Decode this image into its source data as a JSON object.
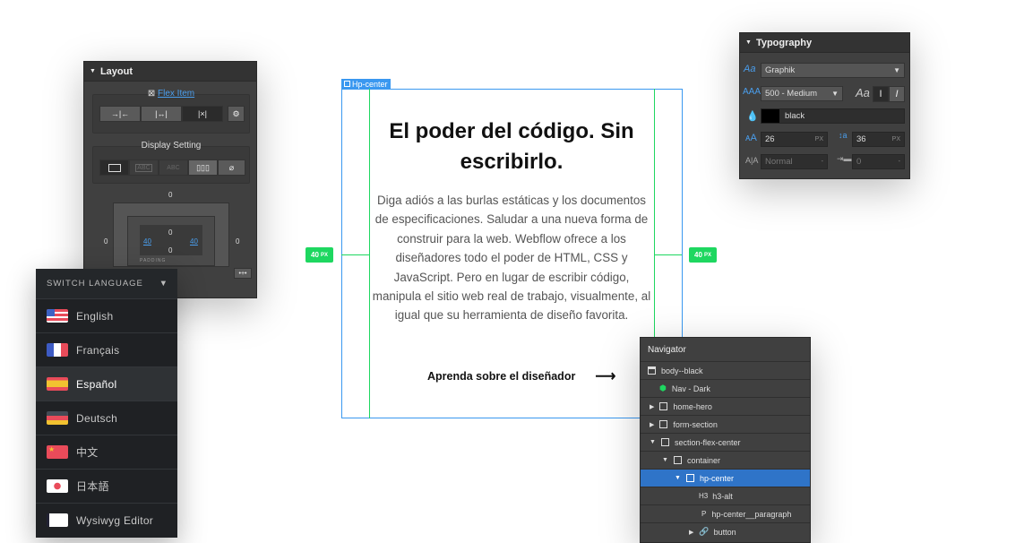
{
  "layout_panel": {
    "title": "Layout",
    "flex_item_label": "Flex Item",
    "display_setting_label": "Display Setting",
    "display_options": [
      "block",
      "inline-block",
      "inline",
      "flex",
      "none"
    ],
    "display_texts": [
      "ABC",
      "ABC"
    ],
    "margin": {
      "top": "0",
      "left": "0",
      "right": "0"
    },
    "padding": {
      "top": "0",
      "left": "40",
      "right": "40",
      "bottom": "0",
      "label": "PADDING"
    },
    "more_label": "•+•"
  },
  "language": {
    "title": "SWITCH LANGUAGE",
    "items": [
      {
        "label": "English",
        "flag": "us"
      },
      {
        "label": "Français",
        "flag": "fr"
      },
      {
        "label": "Español",
        "flag": "es",
        "selected": true
      },
      {
        "label": "Deutsch",
        "flag": "de"
      },
      {
        "label": "中文",
        "flag": "cn"
      },
      {
        "label": "日本語",
        "flag": "jp"
      },
      {
        "label": "Wysiwyg Editor",
        "flag": "doc"
      }
    ]
  },
  "canvas": {
    "element_label": "Hp-center",
    "padding_left": "40",
    "padding_right": "40",
    "unit": "PX",
    "heading": "El poder del código. Sin escribirlo.",
    "paragraph": "Diga adiós a las burlas estáticas y los documentos de especificaciones. Saludar a una nueva forma de construir para la web. Webflow ofrece a los diseñadores todo el poder de HTML, CSS y JavaScript. Pero en lugar de escribir código, manipula el sitio web real de trabajo, visualmente, al igual que su herramienta de diseño favorita.",
    "cta": "Aprenda sobre el diseñador",
    "accent": "#3a98f0",
    "guide_color": "#1ed760"
  },
  "typography": {
    "title": "Typography",
    "font": "Graphik",
    "weight": "500 - Medium",
    "color_name": "black",
    "color": "#000000",
    "size": "26",
    "line_height": "36",
    "unit": "PX",
    "letter_spacing": "Normal",
    "text_indent": "0",
    "dash": "-"
  },
  "navigator": {
    "title": "Navigator",
    "items": [
      {
        "label": "body--black",
        "icon": "body"
      },
      {
        "label": "Nav - Dark",
        "icon": "symbol"
      },
      {
        "label": "home-hero",
        "icon": "box",
        "caret": "right"
      },
      {
        "label": "form-section",
        "icon": "box",
        "caret": "right"
      },
      {
        "label": "section-flex-center",
        "icon": "box",
        "caret": "down"
      },
      {
        "label": "container",
        "icon": "box",
        "caret": "down"
      },
      {
        "label": "hp-center",
        "icon": "box",
        "caret": "down",
        "selected": true
      },
      {
        "label": "h3-alt",
        "icon": "H3"
      },
      {
        "label": "hp-center__paragraph",
        "icon": "P"
      },
      {
        "label": "button",
        "icon": "link",
        "caret": "right"
      }
    ]
  }
}
